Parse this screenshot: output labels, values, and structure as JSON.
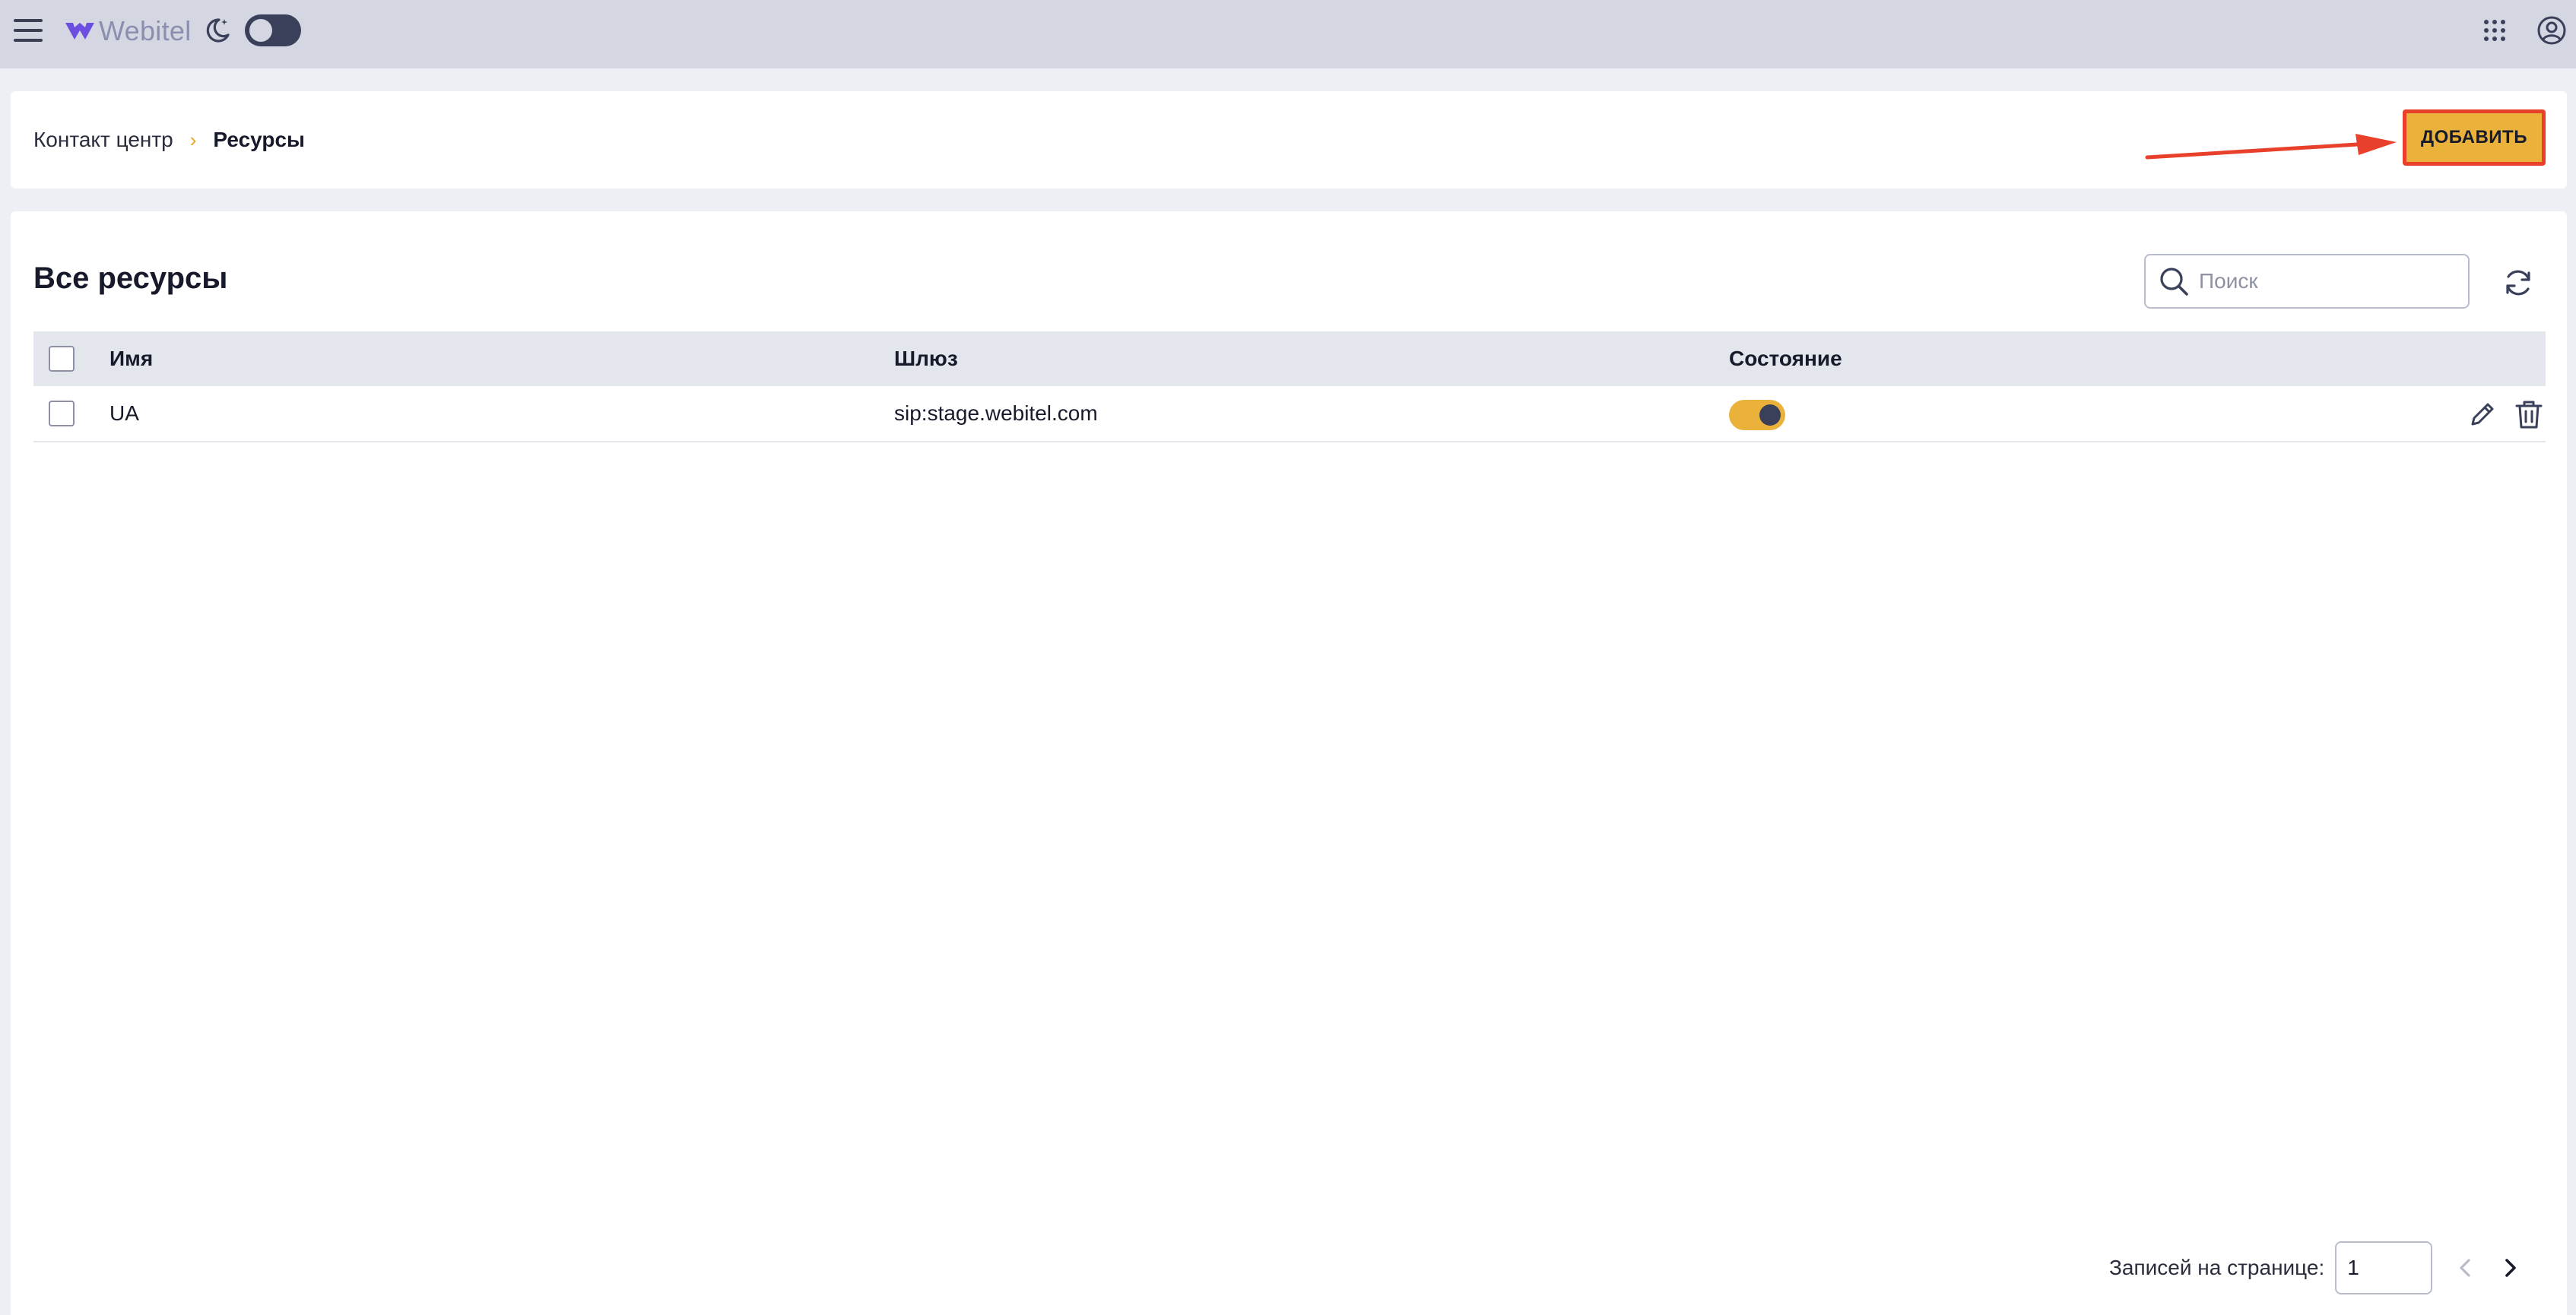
{
  "app": {
    "logo_text": "Webitel",
    "brand_color": "#6c4ee0",
    "accent_color": "#eab23b",
    "highlight_color": "#e8402a"
  },
  "topbar": {
    "icons": [
      "menu-icon",
      "moon-icon",
      "apps-grid-icon",
      "account-icon"
    ],
    "dark_mode_enabled": false
  },
  "breadcrumb": {
    "parent": "Контакт центр",
    "separator": "›",
    "current": "Ресурсы"
  },
  "header": {
    "add_label": "ДОБАВИТЬ"
  },
  "list": {
    "title": "Все ресурсы",
    "search_placeholder": "Поиск",
    "columns": {
      "name": "Имя",
      "gateway": "Шлюз",
      "state": "Состояние"
    },
    "rows": [
      {
        "name": "UA",
        "gateway": "sip:stage.webitel.com",
        "state_enabled": true
      }
    ]
  },
  "pagination": {
    "label": "Записей на странице:",
    "page_size": "1"
  }
}
